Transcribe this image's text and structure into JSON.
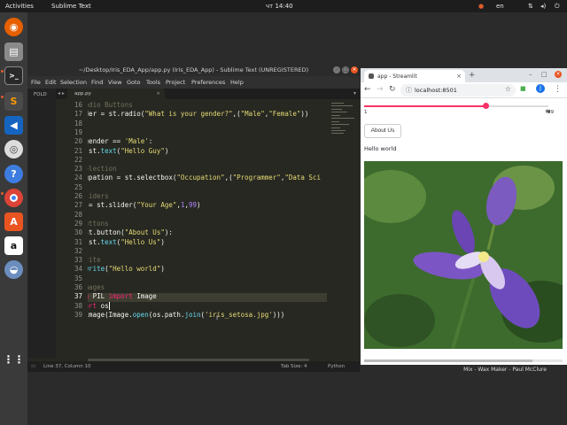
{
  "topbar": {
    "activities": "Activities",
    "app": "Sublime Text",
    "clock": "чт 14:40",
    "lang": "en",
    "power": "⏻"
  },
  "dock": {
    "items": [
      "firefox-icon",
      "files-icon",
      "terminal-icon",
      "sublime-icon",
      "vscode-icon",
      "disk-icon",
      "help-icon",
      "chrome-icon",
      "software-icon",
      "amazon-icon",
      "disks-icon",
      "app-grid-icon"
    ]
  },
  "sublime": {
    "title": "~/Desktop/Iris_EDA_App/app.py (Iris_EDA_App) - Sublime Text (UNREGISTERED)",
    "menu": [
      "File",
      "Edit",
      "Selection",
      "Find",
      "View",
      "Goto",
      "Tools",
      "Project",
      "Preferences",
      "Help"
    ],
    "sidebar_label": "FOLD",
    "tab": "app.py",
    "line_numbers": [
      "16",
      "17",
      "18",
      "19",
      "20",
      "21",
      "22",
      "23",
      "24",
      "25",
      "26",
      "27",
      "28",
      "29",
      "30",
      "31",
      "32",
      "33",
      "34",
      "35",
      "36",
      "37",
      "38",
      "39"
    ],
    "status_left": "Line 37, Column 10",
    "status_tab": "Tab Size: 4",
    "status_lang": "Python"
  },
  "chrome": {
    "tab_title": "app - Streamlit",
    "url": "localhost:8501",
    "slider_value": 0.66,
    "slider_min": "1",
    "slider_max": "99",
    "about_button": "About Us",
    "hello": "Hello world"
  },
  "bottom_music": "Mix - Wax Maker - Paul McClure",
  "colors": {
    "streamlit_accent": "#f63366",
    "sublime_bg": "#272822"
  }
}
